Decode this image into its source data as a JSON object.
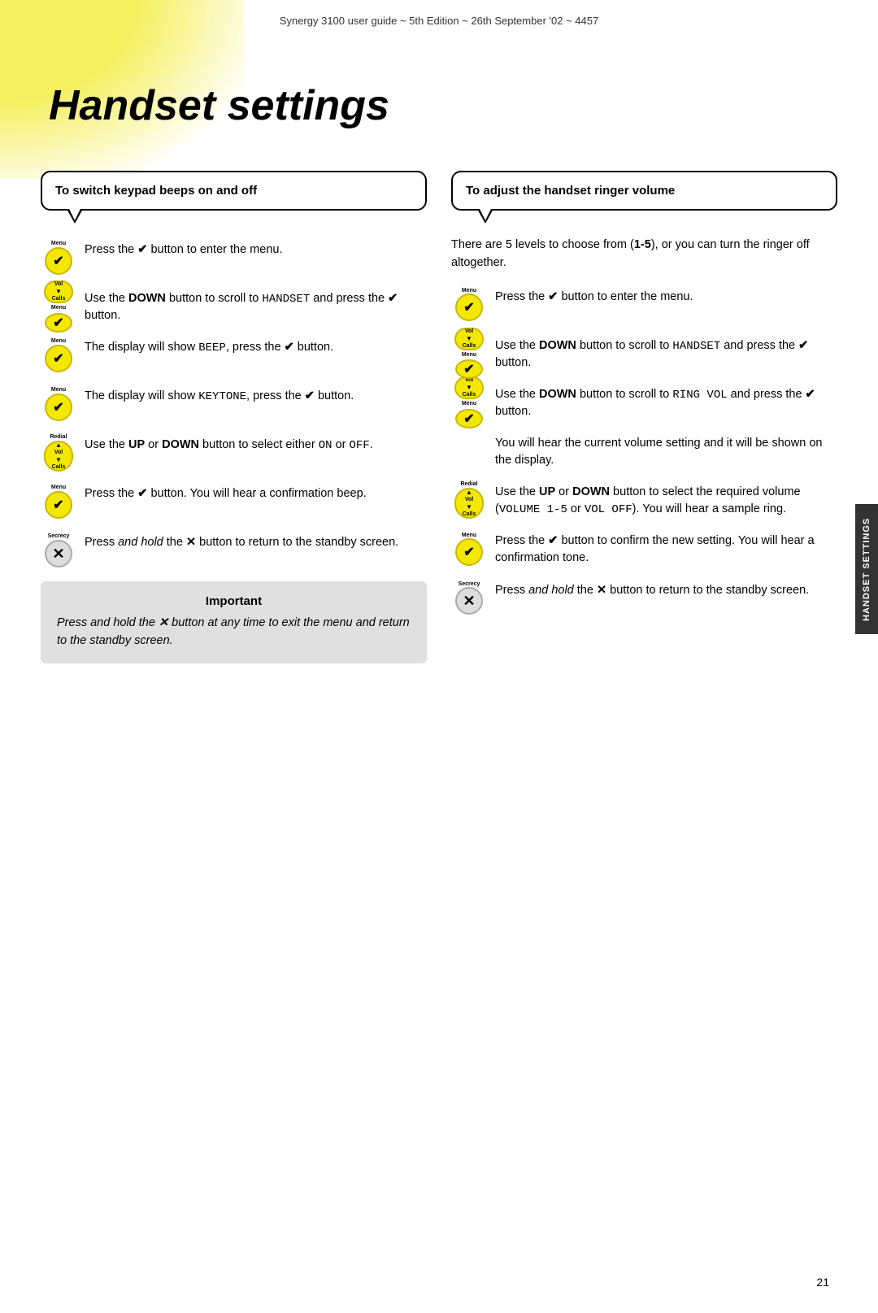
{
  "header": {
    "text": "Synergy 3100 user guide ~ 5th Edition ~ 26th September '02 ~ 4457"
  },
  "page_title": "Handset settings",
  "side_tab": "HANDSET SETTINGS",
  "page_number": "21",
  "left_column": {
    "bubble_title": "To switch keypad beeps on and off",
    "instructions": [
      {
        "btn_type": "menu",
        "text": "Press the ✔ button to enter the menu."
      },
      {
        "btn_type": "vol_menu",
        "text_bold_prefix": "DOWN",
        "text": "Use the DOWN button to scroll to HANDSET and press the ✔ button."
      },
      {
        "btn_type": "menu",
        "text": "The display will show BEEP, press the ✔ button."
      },
      {
        "btn_type": "menu",
        "text": "The display will show KEYTONE, press the ✔ button."
      },
      {
        "btn_type": "redial",
        "text": "Use the UP or DOWN button to select either ON or OFF."
      },
      {
        "btn_type": "menu",
        "text": "Press the ✔ button. You will hear a confirmation beep."
      },
      {
        "btn_type": "secrecy",
        "text": "Press and hold the ✕ button to return to the standby screen."
      }
    ],
    "important": {
      "title": "Important",
      "text": "Press and hold the ✕ button at any time to exit the menu and return to the standby screen."
    }
  },
  "right_column": {
    "bubble_title": "To adjust the handset ringer volume",
    "intro": "There are 5 levels to choose from (1-5), or you can turn the ringer off altogether.",
    "instructions": [
      {
        "btn_type": "menu",
        "text": "Press the ✔ button to enter the menu."
      },
      {
        "btn_type": "vol_menu",
        "text": "Use the DOWN button to scroll to HANDSET and press the ✔ button."
      },
      {
        "btn_type": "vol_menu",
        "text": "Use the DOWN button to scroll to RING VOL and press the ✔ button."
      },
      {
        "btn_type": "none",
        "text": "You will hear the current volume setting and it will be shown on the display."
      },
      {
        "btn_type": "redial",
        "text": "Use the UP or DOWN button to select the required volume (VOLUME 1-5 or VOL OFF). You will hear a sample ring."
      },
      {
        "btn_type": "menu",
        "text": "Press the ✔ button to confirm the new setting. You will hear a confirmation tone."
      },
      {
        "btn_type": "secrecy",
        "text": "Press and hold the ✕ button to return to the standby screen."
      }
    ]
  }
}
